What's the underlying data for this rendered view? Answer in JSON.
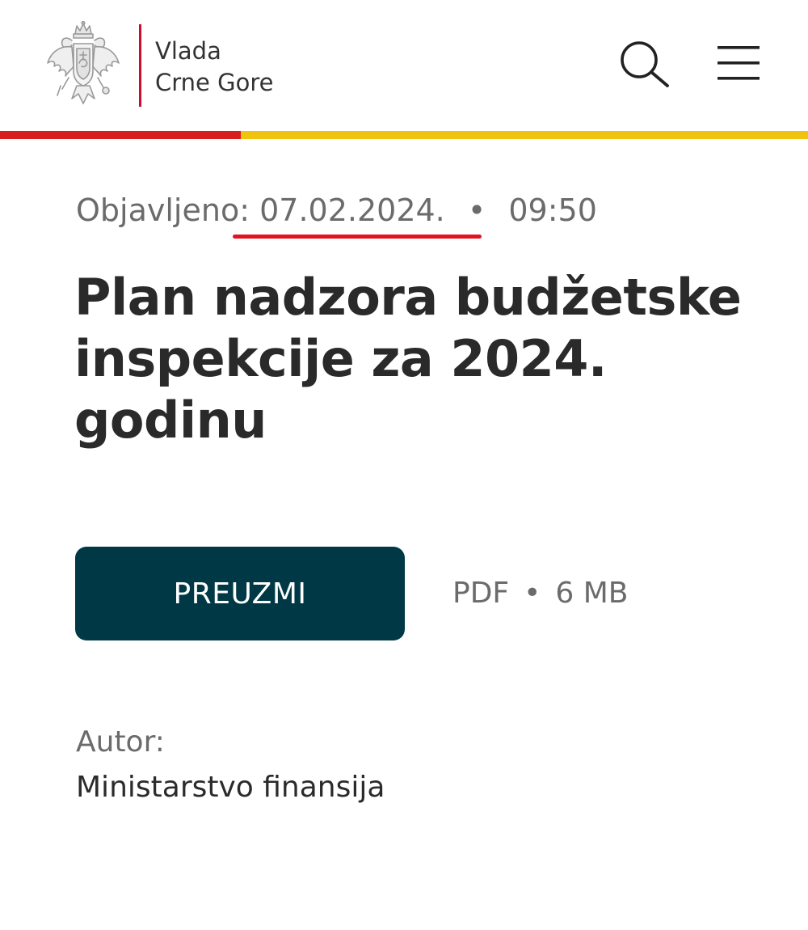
{
  "header": {
    "logo_line1": "Vlada",
    "logo_line2": "Crne Gore",
    "search_icon": "search-icon",
    "menu_icon": "hamburger-menu-icon"
  },
  "colors": {
    "flag_red": "#d81e1e",
    "flag_gold": "#f0c30e",
    "button_bg": "#003945",
    "underline_red": "#e0141e"
  },
  "meta": {
    "published_label": "Objavljeno:",
    "date": "07.02.2024.",
    "separator": "•",
    "time": "09:50"
  },
  "document": {
    "title": "Plan nadzora budžetske inspekcije za 2024. godinu"
  },
  "download": {
    "button_label": "PREUZMI",
    "file_type": "PDF",
    "separator": "•",
    "file_size": "6 MB"
  },
  "author": {
    "label": "Autor:",
    "name": "Ministarstvo finansija"
  }
}
